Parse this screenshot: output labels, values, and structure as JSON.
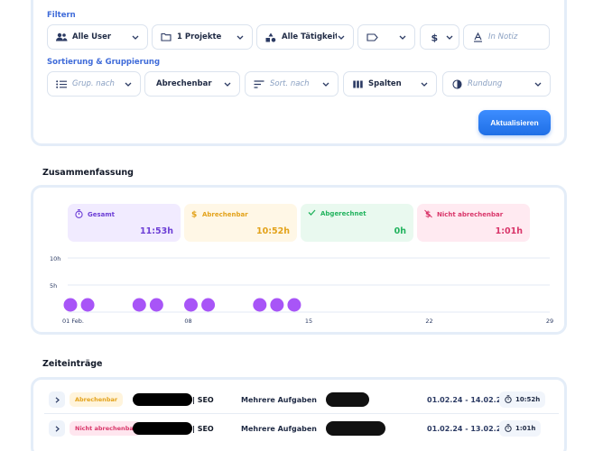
{
  "filters": {
    "section_label": "Filtern",
    "user": "Alle User",
    "projects": "1 Projekte",
    "activities": "Alle Tätigkeiten",
    "note_placeholder": "In Notiz"
  },
  "sorting": {
    "section_label": "Sortierung & Gruppierung",
    "group_placeholder": "Grup. nach",
    "billing": "Abrechenbar",
    "sort_placeholder": "Sort. nach",
    "columns": "Spalten",
    "rounding_placeholder": "Rundung",
    "update_button": "Aktualisieren"
  },
  "summary": {
    "title": "Zusammenfassung",
    "cards": [
      {
        "label": "Gesamt",
        "value": "11:53h",
        "color": "#6d3fd6",
        "bg": "#f1ebff"
      },
      {
        "label": "Abrechenbar",
        "value": "10:52h",
        "color": "#e3a21a",
        "bg": "#fff7e6"
      },
      {
        "label": "Abgerechnet",
        "value": "0h",
        "color": "#22b35e",
        "bg": "#e9f9ef"
      },
      {
        "label": "Nicht abrechenbar",
        "value": "1:01h",
        "color": "#d9366a",
        "bg": "#ffeaf1"
      }
    ]
  },
  "chart_data": {
    "type": "scatter",
    "y_ticks": [
      "10h",
      "5h"
    ],
    "x_ticks": [
      "01 Feb.",
      "08",
      "15",
      "22",
      "29"
    ],
    "x_tick_days": [
      1,
      8,
      15,
      22,
      29
    ],
    "ylim": [
      0,
      10
    ],
    "xlim": [
      1,
      29
    ],
    "point_color": "#a855f7",
    "points": [
      {
        "day": 1,
        "y": 0.4
      },
      {
        "day": 2,
        "y": 0.4
      },
      {
        "day": 5,
        "y": 0.4
      },
      {
        "day": 6,
        "y": 0.4
      },
      {
        "day": 8,
        "y": 0.4
      },
      {
        "day": 9,
        "y": 0.4
      },
      {
        "day": 12,
        "y": 0.4
      },
      {
        "day": 13,
        "y": 0.4
      },
      {
        "day": 14,
        "y": 0.4
      }
    ]
  },
  "entries": {
    "title": "Zeiteinträge",
    "rows": [
      {
        "tag": "Abrechenbar",
        "tag_color": "#e3a21a",
        "tag_bg": "#fff4dc",
        "project": "| SEO",
        "task": "Mehrere Aufgaben",
        "date_range": "01.02.24 - 14.02.24",
        "duration": "10:52h"
      },
      {
        "tag": "Nicht abrechenbar",
        "tag_color": "#d9366a",
        "tag_bg": "#ffe6ef",
        "project": "| SEO",
        "task": "Mehrere Aufgaben",
        "date_range": "01.02.24 - 13.02.24",
        "duration": "1:01h"
      }
    ]
  }
}
